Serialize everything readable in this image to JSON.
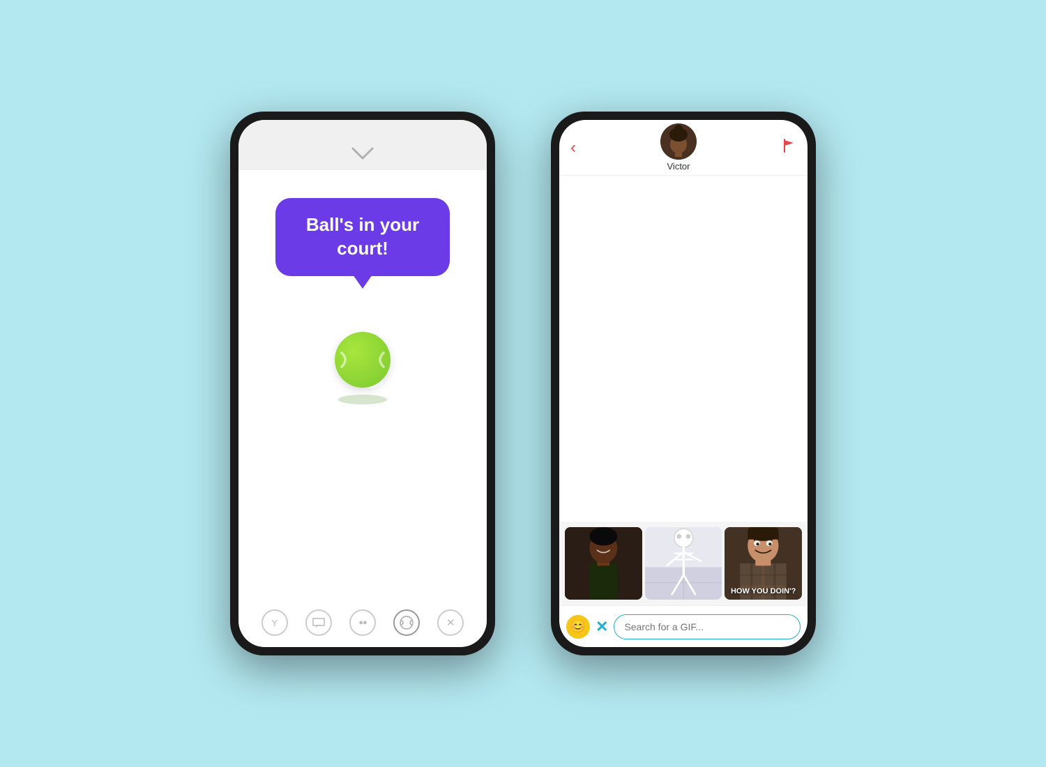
{
  "background": "#b3e8f0",
  "phone1": {
    "speech_bubble": {
      "text": "Ball's in your court!"
    },
    "footer_icons": [
      {
        "name": "y-icon",
        "symbol": "Y"
      },
      {
        "name": "message-icon",
        "symbol": "💬"
      },
      {
        "name": "eyes-icon",
        "symbol": "👀"
      },
      {
        "name": "tennis-icon",
        "symbol": "🎾"
      },
      {
        "name": "x-icon",
        "symbol": "✕"
      }
    ]
  },
  "phone2": {
    "header": {
      "back_label": "‹",
      "user_name": "Victor",
      "flag_label": "⚑"
    },
    "gif_items": [
      {
        "label": "",
        "caption": ""
      },
      {
        "label": "",
        "caption": ""
      },
      {
        "label": "HOW YOU DOIN'?",
        "caption": "HOW YOU DOIN'?"
      }
    ],
    "search_placeholder": "Search for a GIF...",
    "emoji_icon": "😊",
    "close_icon": "✕"
  }
}
